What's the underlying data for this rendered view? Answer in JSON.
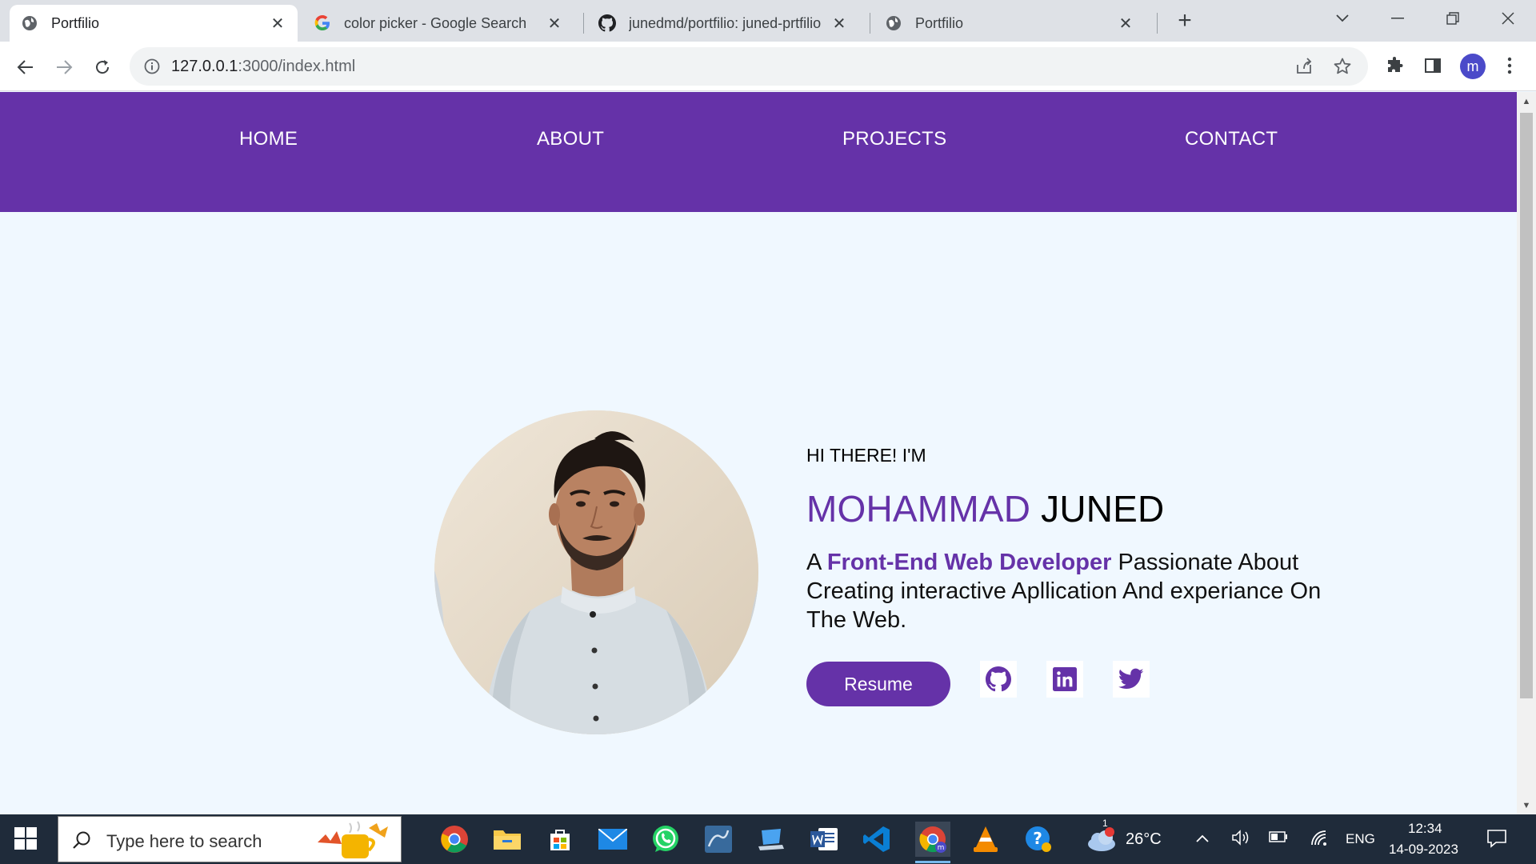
{
  "browser": {
    "tabs": [
      {
        "title": "Portfilio",
        "favicon": "globe-icon",
        "active": true
      },
      {
        "title": "color picker - Google Search",
        "favicon": "google-icon",
        "active": false
      },
      {
        "title": "junedmd/portfilio: juned-prtfilio",
        "favicon": "github-icon",
        "active": false
      },
      {
        "title": "Portfilio",
        "favicon": "globe-icon",
        "active": false
      }
    ],
    "new_tab_label": "+",
    "url_host": "127.0.0.1",
    "url_rest": ":3000/index.html",
    "profile_initial": "m"
  },
  "site": {
    "nav": [
      "HOME",
      "ABOUT",
      "PROJECTS",
      "CONTACT"
    ],
    "hero": {
      "greeting": "HI THERE! I'M",
      "first_name": "MOHAMMAD",
      "last_name": "JUNED",
      "tagline_prefix": "A",
      "tagline_role": "Front-End Web Developer",
      "tagline_suffix": "Passionate About Creating interactive Apllication And experiance On The Web.",
      "resume_label": "Resume",
      "social": [
        "github-icon",
        "linkedin-icon",
        "twitter-icon"
      ]
    },
    "accent_color": "#6532a8",
    "background_color": "#f0f8ff"
  },
  "taskbar": {
    "search_placeholder": "Type here to search",
    "weather": "26°C",
    "weather_badge": "1",
    "language": "ENG",
    "time": "12:34",
    "date": "14-09-2023"
  }
}
